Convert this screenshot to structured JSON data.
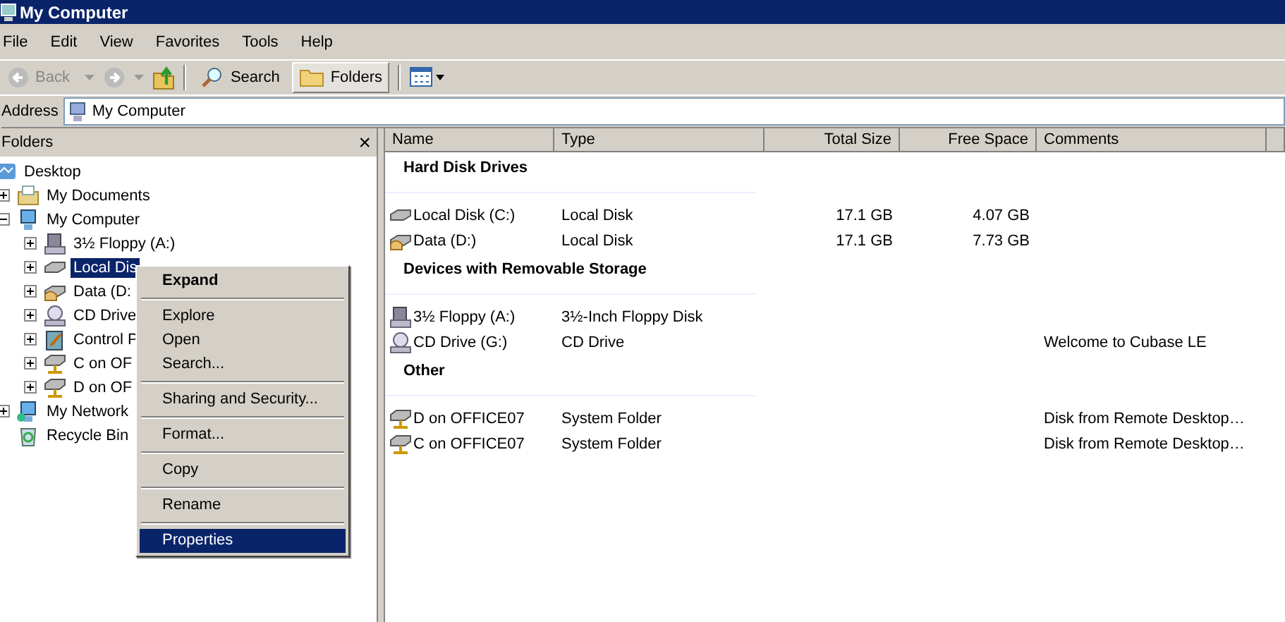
{
  "window": {
    "title": "My Computer"
  },
  "menu_bar": [
    "File",
    "Edit",
    "View",
    "Favorites",
    "Tools",
    "Help"
  ],
  "toolbar": {
    "back": "Back",
    "search": "Search",
    "folders": {
      "label": "Folders",
      "selected": true
    }
  },
  "address": {
    "label": "Address",
    "value": "My Computer"
  },
  "folders_pane": {
    "title": "Folders",
    "close": "×",
    "tree": [
      {
        "label": "Desktop",
        "kind": "desktop",
        "selected": false,
        "children": [
          {
            "label": "My Documents",
            "kind": "documents",
            "expanded": false,
            "selected": false
          },
          {
            "label": "My Computer",
            "kind": "computer",
            "expanded": true,
            "selected": false,
            "children": [
              {
                "label": "3½ Floppy (A:)",
                "kind": "floppy",
                "expanded": false,
                "selected": false
              },
              {
                "label": "Local Dis",
                "kind": "disk",
                "expanded": false,
                "selected": true
              },
              {
                "label": "Data (D:",
                "kind": "shared-disk",
                "expanded": false,
                "selected": false
              },
              {
                "label": "CD Drive",
                "kind": "cd",
                "expanded": false,
                "selected": false
              },
              {
                "label": "Control P",
                "kind": "control",
                "expanded": false,
                "selected": false
              },
              {
                "label": "C on OF",
                "kind": "network-drive",
                "expanded": false,
                "selected": false
              },
              {
                "label": "D on OF",
                "kind": "network-drive",
                "expanded": false,
                "selected": false
              }
            ]
          },
          {
            "label": "My Network",
            "kind": "network",
            "expanded": false,
            "selected": false
          },
          {
            "label": "Recycle Bin",
            "kind": "recycle",
            "selected": false
          }
        ]
      }
    ]
  },
  "table": {
    "columns": [
      "Name",
      "Type",
      "Total Size",
      "Free Space",
      "Comments"
    ],
    "groups": [
      {
        "title": "Hard Disk Drives",
        "rows": [
          {
            "kind": "disk",
            "name": "Local Disk (C:)",
            "type": "Local Disk",
            "total": "17.1 GB",
            "free": "4.07 GB"
          },
          {
            "kind": "shared-disk",
            "name": "Data (D:)",
            "type": "Local Disk",
            "total": "17.1 GB",
            "free": "7.73 GB"
          }
        ]
      },
      {
        "title": "Devices with Removable Storage",
        "rows": [
          {
            "kind": "floppy",
            "name": "3½ Floppy (A:)",
            "type": "3½-Inch Floppy Disk"
          },
          {
            "kind": "cd",
            "name": "CD Drive (G:)",
            "type": "CD Drive",
            "comment": "Welcome to Cubase LE"
          }
        ]
      },
      {
        "title": "Other",
        "rows": [
          {
            "kind": "network-drive",
            "name": "D on OFFICE07",
            "type": "System Folder",
            "comment": "Disk from Remote Desktop…"
          },
          {
            "kind": "network-drive",
            "name": "C on OFFICE07",
            "type": "System Folder",
            "comment": "Disk from Remote Desktop…"
          }
        ]
      }
    ]
  },
  "context_menu": [
    {
      "kind": "item",
      "label": "Expand",
      "default": true,
      "selected": false
    },
    {
      "kind": "separator"
    },
    {
      "kind": "item",
      "label": "Explore",
      "default": false,
      "selected": false
    },
    {
      "kind": "item",
      "label": "Open",
      "default": false,
      "selected": false
    },
    {
      "kind": "item",
      "label": "Search...",
      "default": false,
      "selected": false
    },
    {
      "kind": "separator"
    },
    {
      "kind": "item",
      "label": "Sharing and Security...",
      "default": false,
      "selected": false
    },
    {
      "kind": "separator"
    },
    {
      "kind": "item",
      "label": "Format...",
      "default": false,
      "selected": false
    },
    {
      "kind": "separator"
    },
    {
      "kind": "item",
      "label": "Copy",
      "default": false,
      "selected": false
    },
    {
      "kind": "separator"
    },
    {
      "kind": "item",
      "label": "Rename",
      "default": false,
      "selected": false
    },
    {
      "kind": "separator"
    },
    {
      "kind": "item",
      "label": "Properties",
      "default": false,
      "selected": true
    }
  ]
}
